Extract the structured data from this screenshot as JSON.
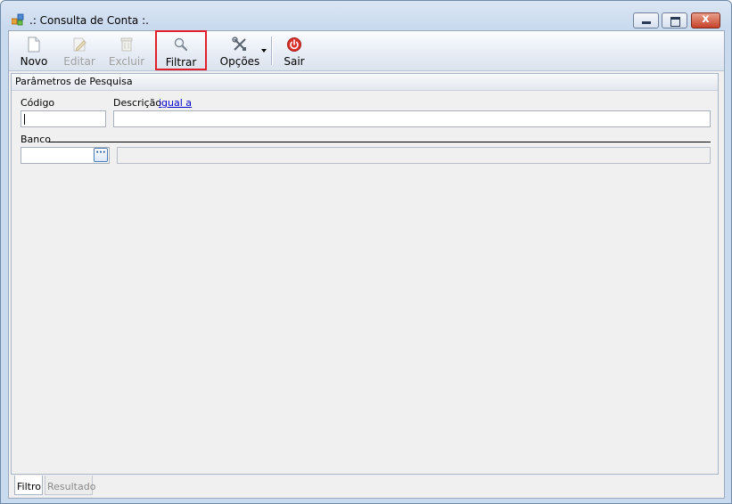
{
  "window": {
    "title": ".: Consulta de Conta :.",
    "close_glyph": "x"
  },
  "toolbar": {
    "items": [
      {
        "label": "Novo",
        "icon": "new-document-icon",
        "enabled": true
      },
      {
        "label": "Editar",
        "icon": "edit-pencil-icon",
        "enabled": false
      },
      {
        "label": "Excluir",
        "icon": "trash-icon",
        "enabled": false
      },
      {
        "label": "Filtrar",
        "icon": "magnifier-icon",
        "enabled": true,
        "highlighted": true
      },
      {
        "label": "Opções",
        "icon": "tools-icon",
        "enabled": true,
        "has_dropdown": true
      },
      {
        "label": "Sair",
        "icon": "power-icon",
        "enabled": true
      }
    ]
  },
  "search_params": {
    "title": "Parâmetros de Pesquisa",
    "codigo_label": "Código",
    "codigo_value": "",
    "descricao_label": "Descrição",
    "descricao_mode_link": "igual a",
    "descricao_value": "",
    "banco_label": "Banco",
    "banco_code_value": "",
    "banco_lookup_glyph": "···",
    "banco_name_value": ""
  },
  "tabs": [
    {
      "label": "Filtro",
      "active": true
    },
    {
      "label": "Resultado",
      "active": false
    }
  ],
  "colors": {
    "highlight_border": "#e0202a",
    "link": "#0000cc",
    "sair_icon": "#d9302a"
  }
}
